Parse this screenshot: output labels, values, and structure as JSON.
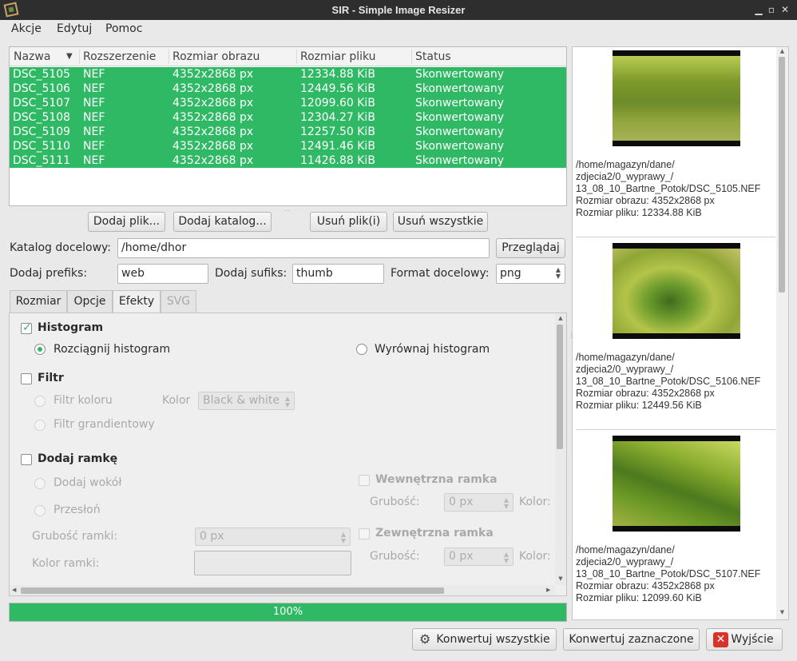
{
  "window": {
    "title": "SIR - Simple Image Resizer"
  },
  "menu": [
    "Akcje",
    "Edytuj",
    "Pomoc"
  ],
  "table": {
    "headers": [
      "Nazwa",
      "Rozszerzenie",
      "Rozmiar obrazu",
      "Rozmiar pliku",
      "Status"
    ],
    "rows": [
      [
        "DSC_5105",
        "NEF",
        "4352x2868 px",
        "12334.88 KiB",
        "Skonwertowany"
      ],
      [
        "DSC_5106",
        "NEF",
        "4352x2868 px",
        "12449.56 KiB",
        "Skonwertowany"
      ],
      [
        "DSC_5107",
        "NEF",
        "4352x2868 px",
        "12099.60 KiB",
        "Skonwertowany"
      ],
      [
        "DSC_5108",
        "NEF",
        "4352x2868 px",
        "12304.27 KiB",
        "Skonwertowany"
      ],
      [
        "DSC_5109",
        "NEF",
        "4352x2868 px",
        "12257.50 KiB",
        "Skonwertowany"
      ],
      [
        "DSC_5110",
        "NEF",
        "4352x2868 px",
        "12491.46 KiB",
        "Skonwertowany"
      ],
      [
        "DSC_5111",
        "NEF",
        "4352x2868 px",
        "11426.88 KiB",
        "Skonwertowany"
      ]
    ]
  },
  "file_buttons": {
    "add_file": "Dodaj plik...",
    "add_dir": "Dodaj katalog...",
    "remove_file": "Usuń plik(i)",
    "remove_all": "Usuń wszystkie"
  },
  "form": {
    "target_dir_label": "Katalog docelowy:",
    "target_dir": "/home/dhor",
    "browse": "Przeglądaj",
    "prefix_label": "Dodaj prefiks:",
    "prefix": "web",
    "suffix_label": "Dodaj sufiks:",
    "suffix": "thumb",
    "format_label": "Format docelowy:",
    "format": "png"
  },
  "tabs": [
    "Rozmiar",
    "Opcje",
    "Efekty",
    "SVG"
  ],
  "effects": {
    "histogram": "Histogram",
    "stretch": "Rozciągnij histogram",
    "equalize": "Wyrównaj histogram",
    "filter": "Filtr",
    "color_filter": "Filtr koloru",
    "color_label": "Kolor",
    "color_value": "Black & white",
    "gradient_filter": "Filtr grandientowy",
    "frame": "Dodaj ramkę",
    "frame_around": "Dodaj wokół",
    "frame_overlay": "Przesłoń",
    "frame_width_label": "Grubość ramki:",
    "frame_width": "0 px",
    "frame_color_label": "Kolor ramki:",
    "inner_frame": "Wewnętrzna ramka",
    "inner_width_label": "Grubość:",
    "inner_width": "0 px",
    "inner_color_label": "Kolor:",
    "outer_frame": "Zewnętrzna ramka",
    "outer_width_label": "Grubość:",
    "outer_width": "0 px",
    "outer_color_label": "Kolor:"
  },
  "progress": {
    "value": 100,
    "text": "100%"
  },
  "actions": {
    "convert_all": "Konwertuj wszystkie",
    "convert_selected": "Konwertuj zaznaczone",
    "exit": "Wyjście"
  },
  "previews": [
    {
      "path1": "/home/magazyn/dane/",
      "path2": "zdjecia2/0_wyprawy_/",
      "path3": "13_08_10_Bartne_Potok/DSC_5105.NEF",
      "image_size": "Rozmiar obrazu: 4352x2868 px",
      "file_size": "Rozmiar pliku: 12334.88 KiB"
    },
    {
      "path1": "/home/magazyn/dane/",
      "path2": "zdjecia2/0_wyprawy_/",
      "path3": "13_08_10_Bartne_Potok/DSC_5106.NEF",
      "image_size": "Rozmiar obrazu: 4352x2868 px",
      "file_size": "Rozmiar pliku: 12449.56 KiB"
    },
    {
      "path1": "/home/magazyn/dane/",
      "path2": "zdjecia2/0_wyprawy_/",
      "path3": "13_08_10_Bartne_Potok/DSC_5107.NEF",
      "image_size": "Rozmiar obrazu: 4352x2868 px",
      "file_size": "Rozmiar pliku: 12099.60 KiB"
    }
  ],
  "colors": {
    "accent": "#2fb964",
    "titlebar": "#2e2e2e",
    "exit_icon": "#d7322c"
  }
}
